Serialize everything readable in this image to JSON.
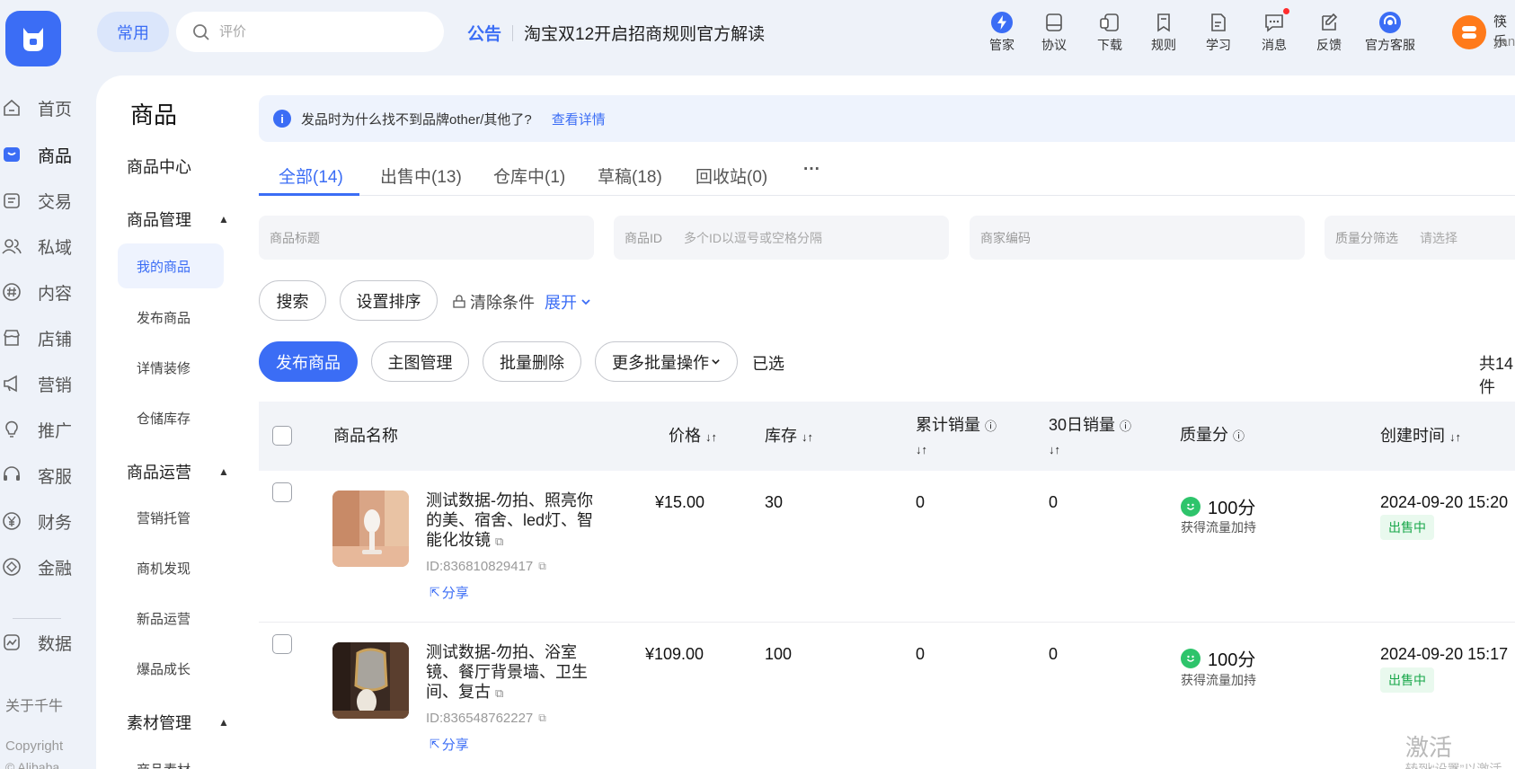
{
  "header": {
    "chip": "常用",
    "search_placeholder": "评价",
    "notice_tag": "公告",
    "notice_text": "淘宝双12开启招商规则官方解读",
    "tools": [
      {
        "label": "管家",
        "icon": "lightning-icon"
      },
      {
        "label": "协议",
        "icon": "agreement-icon"
      },
      {
        "label": "下载",
        "icon": "download-icon"
      },
      {
        "label": "规则",
        "icon": "rules-icon"
      },
      {
        "label": "学习",
        "icon": "study-icon"
      },
      {
        "label": "消息",
        "icon": "message-icon"
      },
      {
        "label": "反馈",
        "icon": "feedback-icon"
      },
      {
        "label": "官方客服",
        "icon": "support-icon"
      }
    ],
    "user_name": "筷乐",
    "user_id": "yan"
  },
  "rail": {
    "items": [
      {
        "label": "首页",
        "icon": "home-icon"
      },
      {
        "label": "商品",
        "icon": "bag-icon"
      },
      {
        "label": "交易",
        "icon": "order-icon"
      },
      {
        "label": "私域",
        "icon": "people-icon"
      },
      {
        "label": "内容",
        "icon": "hash-icon"
      },
      {
        "label": "店铺",
        "icon": "store-icon"
      },
      {
        "label": "营销",
        "icon": "megaphone-icon"
      },
      {
        "label": "推广",
        "icon": "bulb-icon"
      },
      {
        "label": "客服",
        "icon": "headset-icon"
      },
      {
        "label": "财务",
        "icon": "yen-icon"
      },
      {
        "label": "金融",
        "icon": "finance-icon"
      },
      {
        "label": "数据",
        "icon": "chart-icon"
      }
    ],
    "about": "关于千牛",
    "copyright": "Copyright",
    "copyright2": "© Alibaba"
  },
  "submenu": {
    "title": "商品",
    "center": "商品中心",
    "groups": [
      {
        "label": "商品管理",
        "items": [
          "我的商品",
          "发布商品",
          "详情装修",
          "仓储库存"
        ]
      },
      {
        "label": "商品运营",
        "items": [
          "营销托管",
          "商机发现",
          "新品运营",
          "爆品成长"
        ]
      },
      {
        "label": "素材管理",
        "items": [
          "商品素材"
        ]
      }
    ]
  },
  "info": {
    "icon_text": "i",
    "text": "发品时为什么找不到品牌other/其他了?",
    "link": "查看详情"
  },
  "tabs": [
    "全部(14)",
    "出售中(13)",
    "仓库中(1)",
    "草稿(18)",
    "回收站(0)",
    "···"
  ],
  "filters": [
    {
      "label": "商品标题",
      "placeholder": ""
    },
    {
      "label": "商品ID",
      "placeholder": "多个ID以逗号或空格分隔"
    },
    {
      "label": "商家编码",
      "placeholder": ""
    },
    {
      "label": "质量分筛选",
      "placeholder": "请选择"
    }
  ],
  "actions": {
    "search": "搜索",
    "sort": "设置排序",
    "clear": "清除条件",
    "expand": "展开"
  },
  "batch": {
    "publish": "发布商品",
    "main_image": "主图管理",
    "delete": "批量删除",
    "more": "更多批量操作",
    "selected": "已选",
    "total": "共14件"
  },
  "table": {
    "headers": {
      "name": "商品名称",
      "price": "价格",
      "stock": "库存",
      "total_sales": "累计销量",
      "sales_30d": "30日销量",
      "quality": "质量分",
      "created": "创建时间"
    },
    "rows": [
      {
        "name": "测试数据-勿拍、照亮你的美、宿舍、led灯、智能化妆镜",
        "id": "ID:836810829417",
        "share": "分享",
        "price": "¥15.00",
        "stock": "30",
        "total_sales": "0",
        "sales_30d": "0",
        "score": "100分",
        "score_note": "获得流量加持",
        "created": "2024-09-20 15:20",
        "status": "出售中"
      },
      {
        "name": "测试数据-勿拍、浴室镜、餐厅背景墙、卫生间、复古",
        "id": "ID:836548762227",
        "share": "分享",
        "price": "¥109.00",
        "stock": "100",
        "total_sales": "0",
        "sales_30d": "0",
        "score": "100分",
        "score_note": "获得流量加持",
        "created": "2024-09-20 15:17",
        "status": "出售中"
      }
    ]
  },
  "watermark": {
    "line1": "激活 Windows",
    "line2": "转到“设置”以激活"
  },
  "colors": {
    "accent": "#3b6df5",
    "success": "#18a74a",
    "avatar": "#ff7a1a"
  }
}
